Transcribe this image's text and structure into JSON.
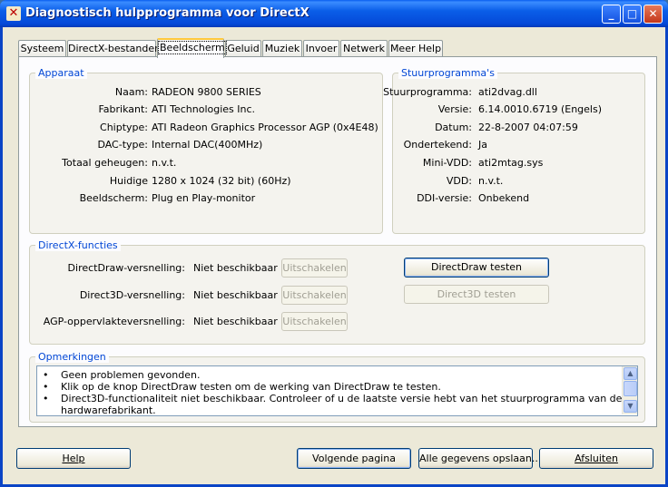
{
  "window": {
    "title": "Diagnostisch hulpprogramma voor DirectX",
    "minimize_glyph": "_",
    "maximize_glyph": "□",
    "close_glyph": "✕"
  },
  "tabs": [
    {
      "label": "Systeem"
    },
    {
      "label": "DirectX-bestanden"
    },
    {
      "label": "Beeldscherm",
      "active": true
    },
    {
      "label": "Geluid"
    },
    {
      "label": "Muziek"
    },
    {
      "label": "Invoer"
    },
    {
      "label": "Netwerk"
    },
    {
      "label": "Meer Help"
    }
  ],
  "device": {
    "title": "Apparaat",
    "rows": [
      {
        "label": "Naam:",
        "value": "RADEON 9800 SERIES"
      },
      {
        "label": "Fabrikant:",
        "value": "ATI Technologies Inc."
      },
      {
        "label": "Chiptype:",
        "value": "ATI Radeon Graphics Processor AGP (0x4E48)"
      },
      {
        "label": "DAC-type:",
        "value": "Internal DAC(400MHz)"
      },
      {
        "label": "Totaal geheugen:",
        "value": "n.v.t."
      },
      {
        "label": "Huidige",
        "value": "1280 x 1024 (32 bit) (60Hz)"
      },
      {
        "label": "Beeldscherm:",
        "value": "Plug en Play-monitor"
      }
    ]
  },
  "drivers": {
    "title": "Stuurprogramma's",
    "rows": [
      {
        "label": "Stuurprogramma:",
        "value": "ati2dvag.dll"
      },
      {
        "label": "Versie:",
        "value": "6.14.0010.6719 (Engels)"
      },
      {
        "label": "Datum:",
        "value": "22-8-2007 04:07:59"
      },
      {
        "label": "Ondertekend:",
        "value": "Ja"
      },
      {
        "label": "Mini-VDD:",
        "value": "ati2mtag.sys"
      },
      {
        "label": "VDD:",
        "value": "n.v.t."
      },
      {
        "label": "DDI-versie:",
        "value": "Onbekend"
      }
    ]
  },
  "directx": {
    "title": "DirectX-functies",
    "rows": [
      {
        "label": "DirectDraw-versnelling:",
        "value": "Niet beschikbaar",
        "button": "Uitschakelen"
      },
      {
        "label": "Direct3D-versnelling:",
        "value": "Niet beschikbaar",
        "button": "Uitschakelen"
      },
      {
        "label": "AGP-oppervlakteversnelling:",
        "value": "Niet beschikbaar",
        "button": "Uitschakelen"
      }
    ],
    "test_directdraw": "DirectDraw testen",
    "test_direct3d": "Direct3D testen"
  },
  "notes": {
    "title": "Opmerkingen",
    "bullet": "•",
    "lines": [
      "Geen problemen gevonden.",
      "Klik op de knop DirectDraw testen om de werking van DirectDraw te testen.",
      "Direct3D-functionaliteit niet beschikbaar. Controleer of u de laatste versie hebt van het stuurprogramma van de",
      "hardwarefabrikant."
    ]
  },
  "footer": {
    "help": "Help",
    "next": "Volgende pagina",
    "save_all": "Alle gegevens opslaan...",
    "exit": "Afsluiten"
  }
}
